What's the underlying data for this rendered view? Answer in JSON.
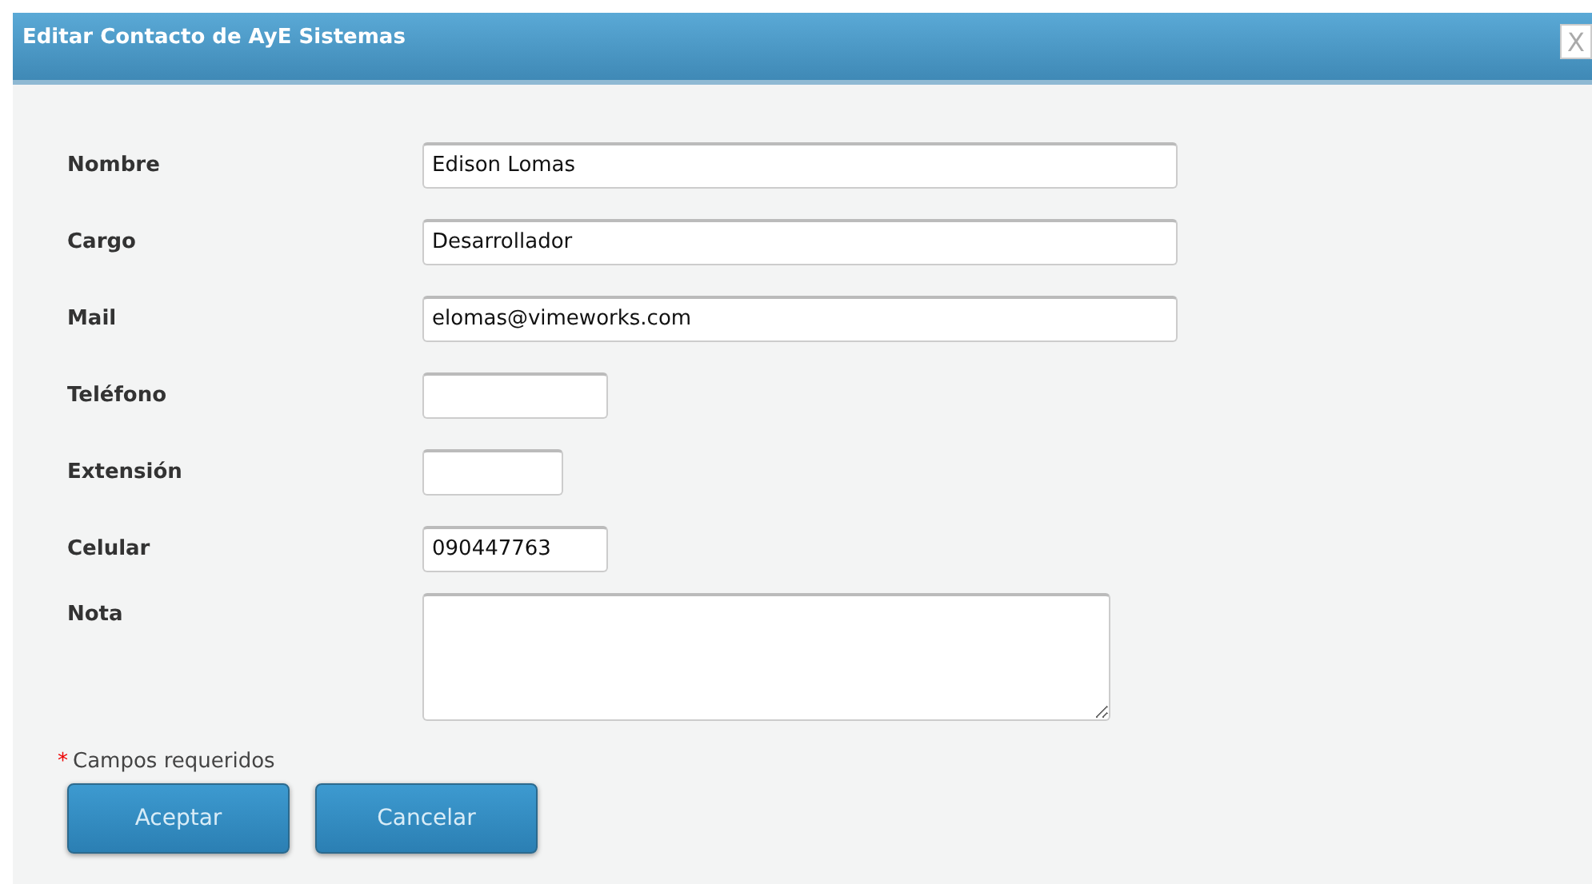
{
  "window": {
    "title": "Editar Contacto de AyE Sistemas",
    "close": "X"
  },
  "fields": [
    {
      "label": "Nombre",
      "kind": "long",
      "value": "Edison Lomas"
    },
    {
      "label": "Cargo",
      "kind": "long",
      "value": "Desarrollador"
    },
    {
      "label": "Mail",
      "kind": "long",
      "value": "elomas@vimeworks.com"
    },
    {
      "label": "Teléfono",
      "kind": "medium"
    },
    {
      "label": "Extensión",
      "kind": "short"
    },
    {
      "label": "Celular",
      "kind": "medium",
      "value": "090447763"
    },
    {
      "label": "Nota",
      "kind": "area"
    }
  ],
  "required_note": {
    "mark": "*",
    "text": "Campos requeridos"
  },
  "buttons": [
    "Aceptar",
    "Cancelar"
  ]
}
